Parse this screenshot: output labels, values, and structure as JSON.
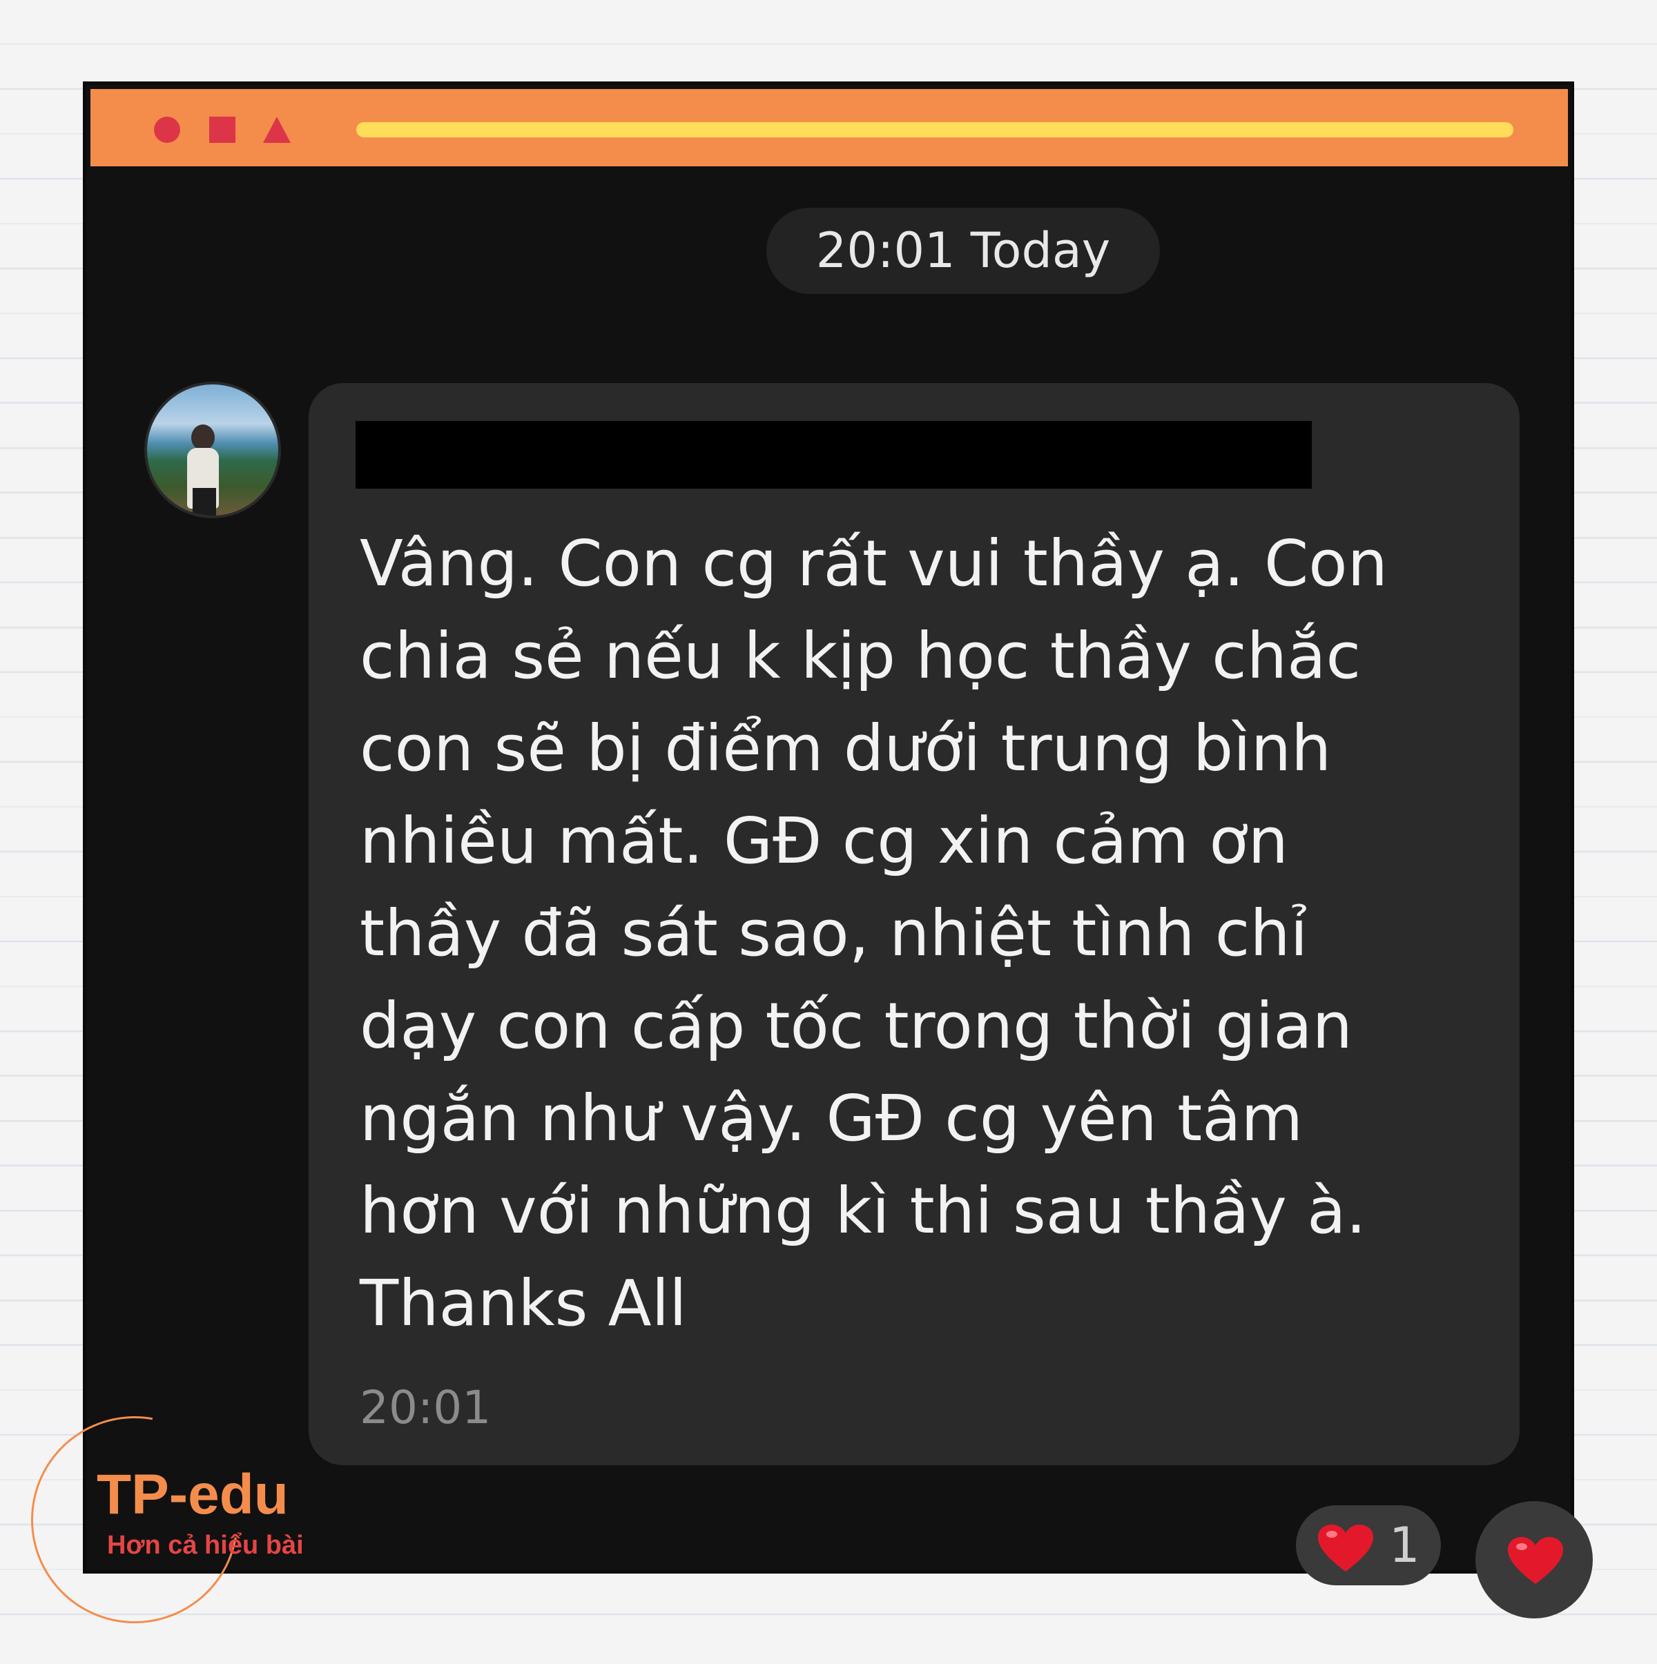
{
  "window": {
    "title_bar_colors": {
      "background": "#f48d4c",
      "shapes": "#dc3548",
      "bar": "#ffdc5a"
    }
  },
  "chat": {
    "date_separator": "20:01 Today",
    "message": {
      "sender_name_redacted": true,
      "text": "Vâng. Con cg rất vui thầy ạ. Con\nchia sẻ nếu k kịp học thầy chắc\ncon sẽ bị điểm dưới trung bình\nnhiều mất. GĐ cg xin cảm ơn\nthầy đã sát sao, nhiệt tình chỉ\ndạy con cấp tốc trong thời gian\nngắn như vậy. GĐ cg yên tâm\nhơn với những kì thi sau thầy à.\nThanks All",
      "time": "20:01",
      "reactions": {
        "icon": "heart-icon",
        "count": "1"
      }
    },
    "react_button_icon": "heart-icon"
  },
  "brand": {
    "name": "TP-edu",
    "tagline": "Hơn cả hiểu bài",
    "colors": {
      "primary": "#f48d4c",
      "tagline": "#e64545"
    }
  }
}
